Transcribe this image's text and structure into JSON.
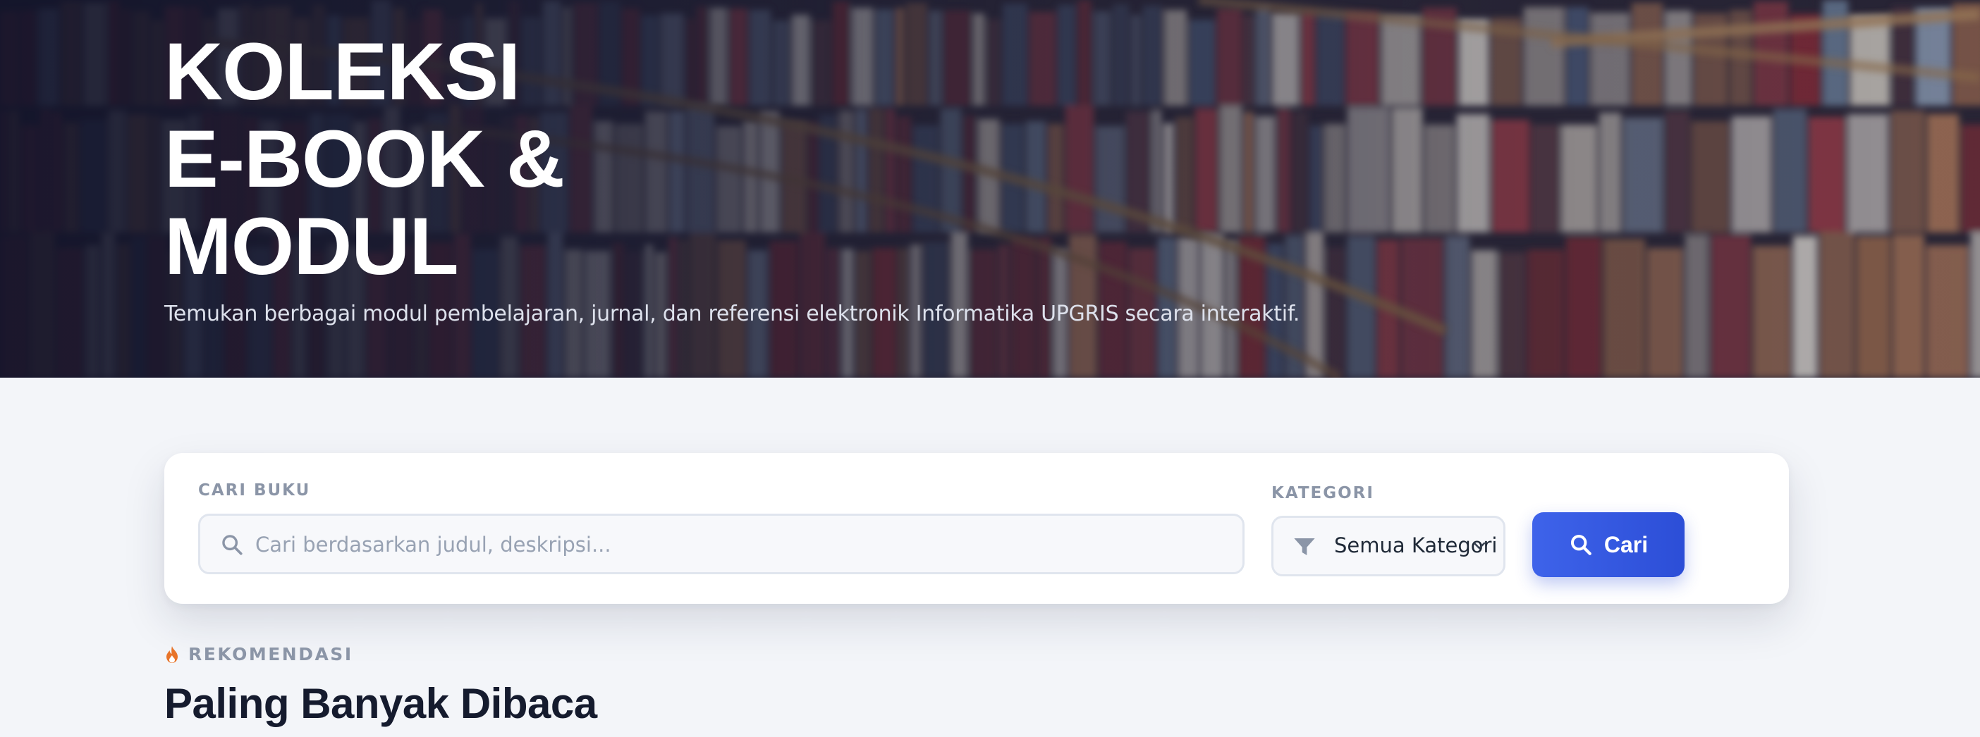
{
  "hero": {
    "title_lines": [
      "KOLEKSI",
      "E-BOOK &",
      "MODUL"
    ],
    "subtitle": "Temukan berbagai modul pembelajaran, jurnal, dan referensi elektronik Informatika UPGRIS secara interaktif."
  },
  "search": {
    "label": "CARI BUKU",
    "placeholder": "Cari berdasarkan judul, deskripsi...",
    "value": "",
    "icon": "search-icon"
  },
  "category": {
    "label": "KATEGORI",
    "selected": "Semua Kategori",
    "icon": "filter-icon"
  },
  "button": {
    "label": "Cari",
    "icon": "search-icon",
    "color": "#3558e0"
  },
  "section": {
    "badge_icon": "fire-icon",
    "badge": "REKOMENDASI",
    "badge_color": "#e8742a",
    "title": "Paling Banyak Dibaca"
  }
}
